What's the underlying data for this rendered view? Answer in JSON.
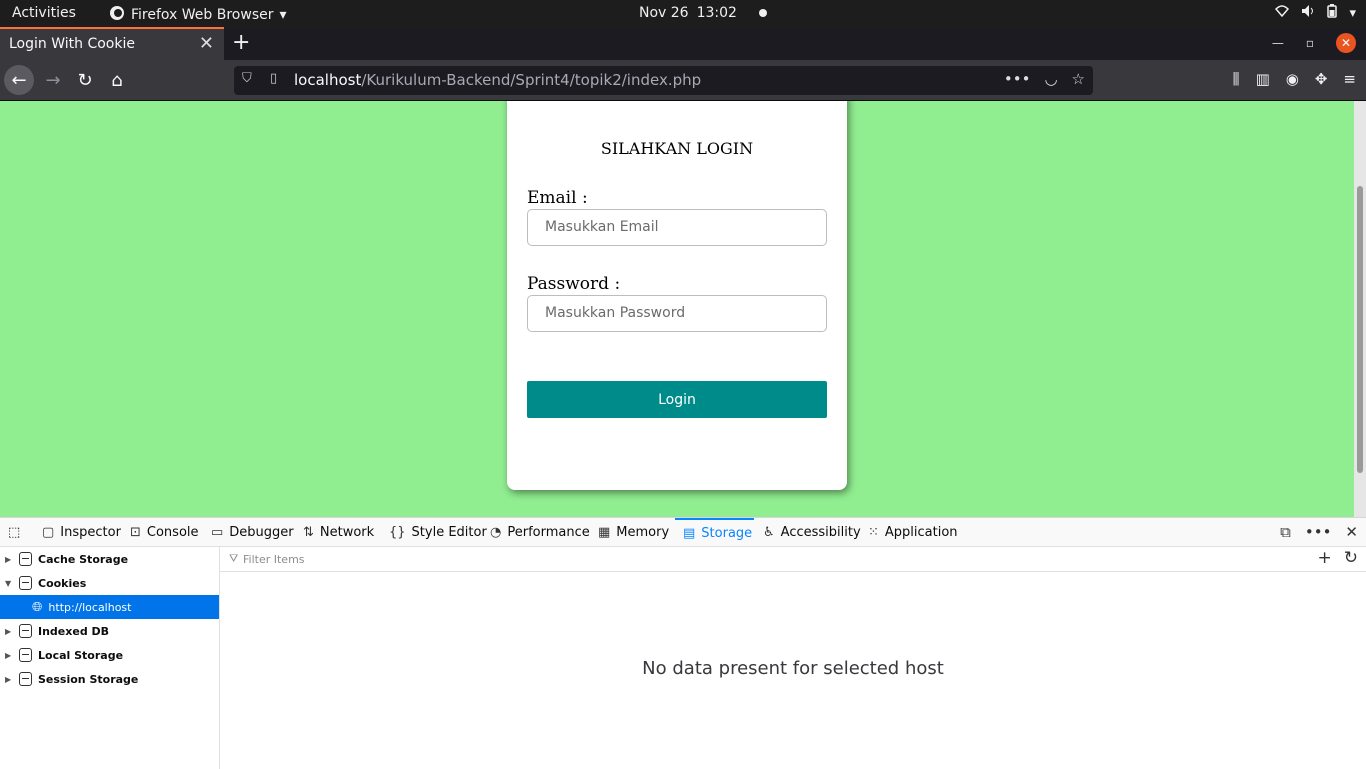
{
  "system_bar": {
    "activities": "Activities",
    "app_name": "Firefox Web Browser",
    "date": "Nov 26",
    "time": "13:02"
  },
  "browser": {
    "tab_title": "Login With Cookie",
    "url_host": "localhost",
    "url_path": "/Kurikulum-Backend/Sprint4/topik2/index.php",
    "accent_color": "#ff7139"
  },
  "page": {
    "background_color": "#90ee90",
    "heading": "SILAHKAN LOGIN",
    "email_label": "Email :",
    "email_placeholder": "Masukkan Email",
    "password_label": "Password :",
    "password_placeholder": "Masukkan Password",
    "login_button": "Login",
    "button_color": "#008b8b"
  },
  "devtools": {
    "tabs": [
      {
        "label": "Inspector",
        "icon": "inspector-icon"
      },
      {
        "label": "Console",
        "icon": "console-icon"
      },
      {
        "label": "Debugger",
        "icon": "debugger-icon"
      },
      {
        "label": "Network",
        "icon": "network-icon"
      },
      {
        "label": "Style Editor",
        "icon": "style-editor-icon"
      },
      {
        "label": "Performance",
        "icon": "performance-icon"
      },
      {
        "label": "Memory",
        "icon": "memory-icon"
      },
      {
        "label": "Storage",
        "icon": "storage-icon"
      },
      {
        "label": "Accessibility",
        "icon": "accessibility-icon"
      },
      {
        "label": "Application",
        "icon": "application-icon"
      }
    ],
    "active_tab": "Storage",
    "tree": [
      {
        "label": "Cache Storage"
      },
      {
        "label": "Cookies"
      },
      {
        "label": "http://localhost"
      },
      {
        "label": "Indexed DB"
      },
      {
        "label": "Local Storage"
      },
      {
        "label": "Session Storage"
      }
    ],
    "filter_placeholder": "Filter Items",
    "empty_message": "No data present for selected host"
  }
}
